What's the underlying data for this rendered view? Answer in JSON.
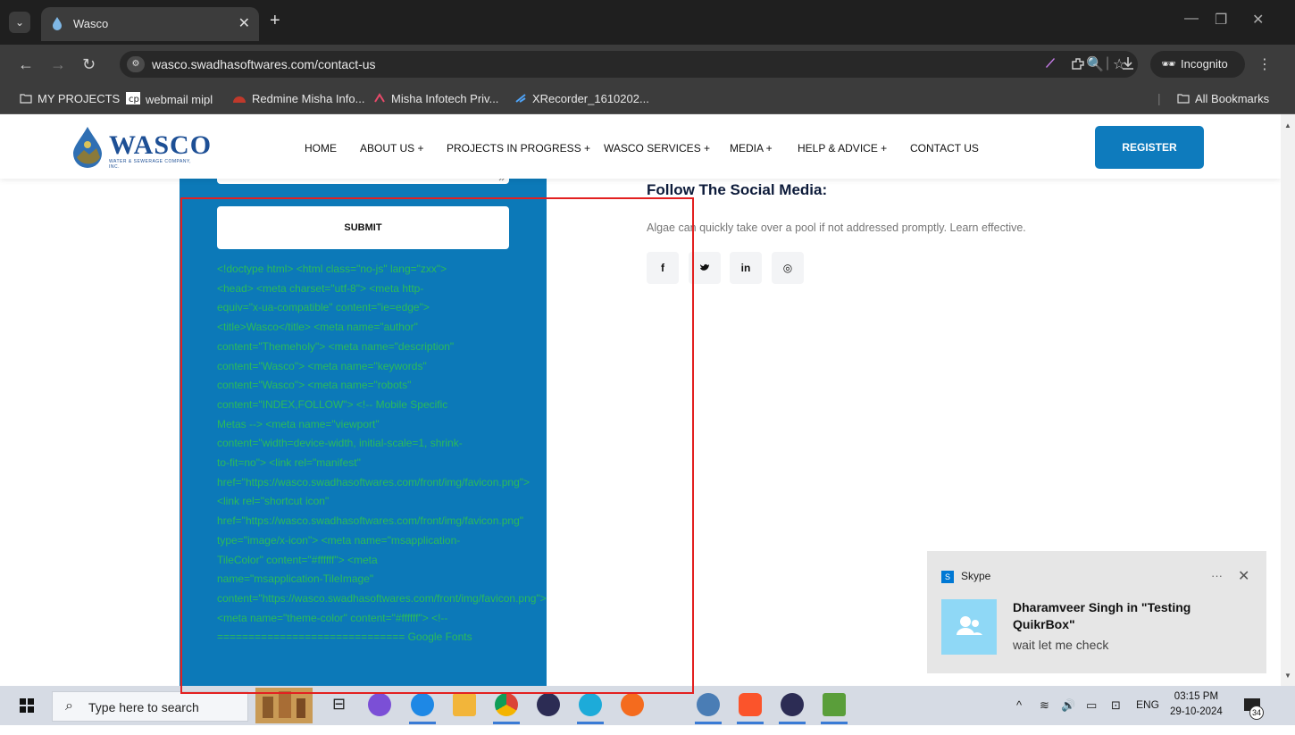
{
  "browser": {
    "tab_title": "Wasco",
    "tab_close": "✕",
    "new_tab": "+",
    "url": "wasco.swadhasoftwares.com/contact-us",
    "incognito_label": "Incognito",
    "bookmarks": [
      {
        "label": "MY PROJECTS"
      },
      {
        "label": "webmail mipl"
      },
      {
        "label": "Redmine Misha Info..."
      },
      {
        "label": "Misha Infotech Priv..."
      },
      {
        "label": "XRecorder_1610202..."
      }
    ],
    "all_bookmarks": "All Bookmarks"
  },
  "site": {
    "logo_name": "WASCO",
    "logo_sub": "WATER & SEWERAGE COMPANY, INC.",
    "menu": [
      {
        "label": "HOME"
      },
      {
        "label": "ABOUT US +"
      },
      {
        "label": "PROJECTS IN PROGRESS +"
      },
      {
        "label": "WASCO SERVICES +"
      },
      {
        "label": "MEDIA +"
      },
      {
        "label": "HELP & ADVICE +"
      },
      {
        "label": "CONTACT US"
      }
    ],
    "register_label": "REGISTER"
  },
  "form": {
    "submit_label": "SUBMIT",
    "leaked_source_lines": [
      "<!doctype html> <html class=\"no-js\" lang=\"zxx\">",
      "<head> <meta charset=\"utf-8\"> <meta http-",
      "equiv=\"x-ua-compatible\" content=\"ie=edge\">",
      "<title>Wasco</title> <meta name=\"author\"",
      "content=\"Themeholy\"> <meta name=\"description\"",
      "content=\"Wasco\"> <meta name=\"keywords\"",
      "content=\"Wasco\"> <meta name=\"robots\"",
      "content=\"INDEX,FOLLOW\"> <!-- Mobile Specific",
      "Metas --> <meta name=\"viewport\"",
      "content=\"width=device-width, initial-scale=1, shrink-",
      "to-fit=no\"> <link rel=\"manifest\"",
      "href=\"https://wasco.swadhasoftwares.com/front/img/favicon.png\">",
      "<link rel=\"shortcut icon\"",
      "href=\"https://wasco.swadhasoftwares.com/front/img/favicon.png\"",
      "type=\"image/x-icon\"> <meta name=\"msapplication-",
      "TileColor\" content=\"#ffffff\"> <meta",
      "name=\"msapplication-TileImage\"",
      "content=\"https://wasco.swadhasoftwares.com/front/img/favicon.png\">",
      "<meta name=\"theme-color\" content=\"#ffffff\"> <!--",
      "============================== Google Fonts"
    ]
  },
  "social": {
    "heading": "Follow The Social Media:",
    "text": "Algae can quickly take over a pool if not addressed promptly. Learn effective.",
    "buttons": [
      {
        "label": "f",
        "icon": "facebook-icon"
      },
      {
        "label": "🐦",
        "icon": "twitter-icon"
      },
      {
        "label": "in",
        "icon": "linkedin-icon"
      },
      {
        "label": "◎",
        "icon": "instagram-icon"
      }
    ]
  },
  "toast": {
    "app": "Skype",
    "more": "···",
    "close": "✕",
    "sender": "Dharamveer Singh in \"Testing QuikrBox\"",
    "message": "wait let me check"
  },
  "taskbar": {
    "search_placeholder": "Type here to search",
    "tray_lang": "ENG",
    "time": "03:15 PM",
    "date": "29-10-2024",
    "notif_count": "34"
  },
  "colors": {
    "brand_blue": "#0c79b8",
    "register_blue": "#0e7bbd",
    "code_green": "#2bbb5a",
    "highlight_red": "#e32020"
  }
}
